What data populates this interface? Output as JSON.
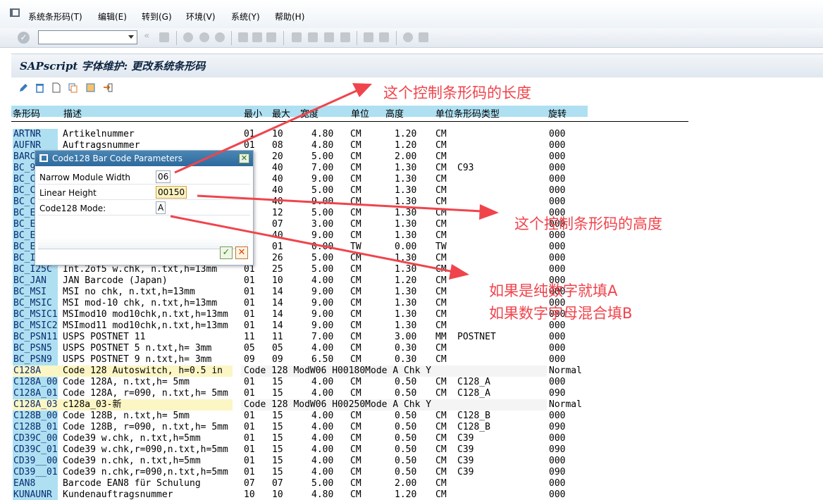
{
  "menu": {
    "items": [
      "系统条形码(T)",
      "编辑(E)",
      "转到(G)",
      "环境(V)",
      "系统(Y)",
      "帮助(H)"
    ]
  },
  "title": "SAPscript 字体维护: 更改系统条形码",
  "columns": {
    "code": "条形码",
    "desc": "描述",
    "min": "最小",
    "max": "最大",
    "width": "宽度",
    "unit": "单位",
    "height": "高度",
    "type": "单位条形码类型",
    "rot": "旋转"
  },
  "rows": [
    {
      "code": "ARTNR",
      "desc": "Artikelnummer",
      "min": "01",
      "max": "10",
      "width": "4.80",
      "unit": "CM",
      "height": "1.20",
      "bunit": "CM",
      "btype": "",
      "rot": "000"
    },
    {
      "code": "AUFNR",
      "desc": "Auftragsnummer",
      "min": "01",
      "max": "08",
      "width": "4.80",
      "unit": "CM",
      "height": "1.20",
      "bunit": "CM",
      "btype": "",
      "rot": "000"
    },
    {
      "code": "BARC",
      "desc": "",
      "min": "",
      "max": "20",
      "width": "5.00",
      "unit": "CM",
      "height": "2.00",
      "bunit": "CM",
      "btype": "",
      "rot": "000"
    },
    {
      "code": "BC_9",
      "desc": "",
      "min": "",
      "max": "40",
      "width": "7.00",
      "unit": "CM",
      "height": "1.30",
      "bunit": "CM",
      "btype": "C93",
      "rot": "000"
    },
    {
      "code": "BC_C",
      "desc": "",
      "min": "",
      "max": "40",
      "width": "9.00",
      "unit": "CM",
      "height": "1.30",
      "bunit": "CM",
      "btype": "",
      "rot": "000"
    },
    {
      "code": "BC_C",
      "desc": "",
      "min": "",
      "max": "40",
      "width": "5.00",
      "unit": "CM",
      "height": "1.30",
      "bunit": "CM",
      "btype": "",
      "rot": "000"
    },
    {
      "code": "BC_C",
      "desc": "",
      "min": "",
      "max": "40",
      "width": "9.00",
      "unit": "CM",
      "height": "1.30",
      "bunit": "CM",
      "btype": "",
      "rot": "000"
    },
    {
      "code": "BC_E",
      "desc": "",
      "min": "",
      "max": "12",
      "width": "5.00",
      "unit": "CM",
      "height": "1.30",
      "bunit": "CM",
      "btype": "",
      "rot": "000"
    },
    {
      "code": "BC_E",
      "desc": "",
      "min": "",
      "max": "07",
      "width": "3.00",
      "unit": "CM",
      "height": "1.30",
      "bunit": "CM",
      "btype": "",
      "rot": "000"
    },
    {
      "code": "BC_E",
      "desc": "",
      "min": "",
      "max": "40",
      "width": "9.00",
      "unit": "CM",
      "height": "1.30",
      "bunit": "CM",
      "btype": "",
      "rot": "000"
    },
    {
      "code": "BC_E",
      "desc": "",
      "min": "",
      "max": "01",
      "width": "0.00",
      "unit": "TW",
      "height": "0.00",
      "bunit": "TW",
      "btype": "",
      "rot": "000"
    },
    {
      "code": "BC_I",
      "desc": "",
      "min": "",
      "max": "26",
      "width": "5.00",
      "unit": "CM",
      "height": "1.30",
      "bunit": "CM",
      "btype": "",
      "rot": "000"
    },
    {
      "code": "BC_I25C",
      "desc": "Int.2of5 w.chk,     n.txt,h=13mm",
      "min": "01",
      "max": "25",
      "width": "5.00",
      "unit": "CM",
      "height": "1.30",
      "bunit": "CM",
      "btype": "",
      "rot": "000"
    },
    {
      "code": "BC_JAN",
      "desc": "JAN Barcode (Japan)",
      "min": "01",
      "max": "10",
      "width": "4.00",
      "unit": "CM",
      "height": "1.20",
      "bunit": "CM",
      "btype": "",
      "rot": "000"
    },
    {
      "code": "BC_MSI",
      "desc": "MSI no chk,         n.txt,h=13mm",
      "min": "01",
      "max": "14",
      "width": "9.00",
      "unit": "CM",
      "height": "1.30",
      "bunit": "CM",
      "btype": "",
      "rot": "000"
    },
    {
      "code": "BC_MSIC",
      "desc": "MSI mod-10 chk,     n.txt,h=13mm",
      "min": "01",
      "max": "14",
      "width": "9.00",
      "unit": "CM",
      "height": "1.30",
      "bunit": "CM",
      "btype": "",
      "rot": "000"
    },
    {
      "code": "BC_MSIC1",
      "desc": "MSImod10 mod10chk,n.txt,h=13mm",
      "min": "01",
      "max": "14",
      "width": "9.00",
      "unit": "CM",
      "height": "1.30",
      "bunit": "CM",
      "btype": "",
      "rot": "000"
    },
    {
      "code": "BC_MSIC2",
      "desc": "MSImod11 mod10chk,n.txt,h=13mm",
      "min": "01",
      "max": "14",
      "width": "9.00",
      "unit": "CM",
      "height": "1.30",
      "bunit": "CM",
      "btype": "",
      "rot": "000"
    },
    {
      "code": "BC_PSN11",
      "desc": "USPS POSTNET 11",
      "min": "11",
      "max": "11",
      "width": "7.00",
      "unit": "CM",
      "height": "3.00",
      "bunit": "MM",
      "btype": "POSTNET",
      "rot": "000"
    },
    {
      "code": "BC_PSN5",
      "desc": "USPS POSTNET 5      n.txt,h= 3mm",
      "min": "05",
      "max": "05",
      "width": "4.00",
      "unit": "CM",
      "height": "0.30",
      "bunit": "CM",
      "btype": "",
      "rot": "000"
    },
    {
      "code": "BC_PSN9",
      "desc": "USPS POSTNET 9      n.txt,h= 3mm",
      "min": "09",
      "max": "09",
      "width": "6.50",
      "unit": "CM",
      "height": "0.30",
      "bunit": "CM",
      "btype": "",
      "rot": "000"
    },
    {
      "code": "C128A",
      "desc": "Code 128 Autoswitch, h=0.5 in",
      "special": "Code 128                 ModW06 H00180Mode A Chk Y",
      "rot": "Normal",
      "highlight": true
    },
    {
      "code": "C128A_00",
      "desc": "Code 128A,          n.txt,h= 5mm",
      "min": "01",
      "max": "15",
      "width": "4.00",
      "unit": "CM",
      "height": "0.50",
      "bunit": "CM",
      "btype": "C128_A",
      "rot": "000"
    },
    {
      "code": "C128A_01",
      "desc": "Code 128A, r=090,   n.txt,h= 5mm",
      "min": "01",
      "max": "15",
      "width": "4.00",
      "unit": "CM",
      "height": "0.50",
      "bunit": "CM",
      "btype": "C128_A",
      "rot": "090"
    },
    {
      "code": "C128A_03",
      "desc": "c128a_03-新",
      "special": "Code 128                 ModW06 H00250Mode A Chk Y",
      "rot": "Normal",
      "highlight": true
    },
    {
      "code": "C128B_00",
      "desc": "Code 128B,          n.txt,h= 5mm",
      "min": "01",
      "max": "15",
      "width": "4.00",
      "unit": "CM",
      "height": "0.50",
      "bunit": "CM",
      "btype": "C128_B",
      "rot": "000"
    },
    {
      "code": "C128B_01",
      "desc": "Code 128B, r=090,   n.txt,h= 5mm",
      "min": "01",
      "max": "15",
      "width": "4.00",
      "unit": "CM",
      "height": "0.50",
      "bunit": "CM",
      "btype": "C128_B",
      "rot": "090"
    },
    {
      "code": "CD39C_00",
      "desc": "Code39 w.chk,       n.txt,h=5mm",
      "min": "01",
      "max": "15",
      "width": "4.00",
      "unit": "CM",
      "height": "0.50",
      "bunit": "CM",
      "btype": "C39",
      "rot": "000"
    },
    {
      "code": "CD39C_01",
      "desc": "Code39 w.chk,r=090,n.txt,h=5mm",
      "min": "01",
      "max": "15",
      "width": "4.00",
      "unit": "CM",
      "height": "0.50",
      "bunit": "CM",
      "btype": "C39",
      "rot": "090"
    },
    {
      "code": "CD39__00",
      "desc": "Code39 n.chk,       n.txt,h=5mm",
      "min": "01",
      "max": "15",
      "width": "4.00",
      "unit": "CM",
      "height": "0.50",
      "bunit": "CM",
      "btype": "C39",
      "rot": "000"
    },
    {
      "code": "CD39__01",
      "desc": "Code39 n.chk,r=090,n.txt,h=5mm",
      "min": "01",
      "max": "15",
      "width": "4.00",
      "unit": "CM",
      "height": "0.50",
      "bunit": "CM",
      "btype": "C39",
      "rot": "090"
    },
    {
      "code": "EAN8",
      "desc": "Barcode EAN8 für Schulung",
      "min": "07",
      "max": "07",
      "width": "5.00",
      "unit": "CM",
      "height": "2.00",
      "bunit": "CM",
      "btype": "",
      "rot": "000"
    },
    {
      "code": "KUNAUNR",
      "desc": "Kundenauftragsnummer",
      "min": "10",
      "max": "10",
      "width": "4.80",
      "unit": "CM",
      "height": "1.20",
      "bunit": "CM",
      "btype": "",
      "rot": "000"
    }
  ],
  "dialog": {
    "title": "Code128 Bar Code Parameters",
    "fields": [
      {
        "label": "Narrow Module Width",
        "value": "06"
      },
      {
        "label": "Linear Height",
        "value": "00150"
      },
      {
        "label": "Code128 Mode:",
        "value": "A"
      }
    ],
    "ok": "✓",
    "cancel": "✕"
  },
  "annotations": {
    "width_note": "这个控制条形码的长度",
    "height_note": "这个控制条形码的高度",
    "mode_note_1": "如果是纯数字就填A",
    "mode_note_2": "如果数字字母混合填B"
  },
  "colors": {
    "header_bg": "#aee0f2",
    "highlight_row": "#fbf6c4",
    "annotation": "#f0444c",
    "dialog_title": "#2d6a9e"
  }
}
